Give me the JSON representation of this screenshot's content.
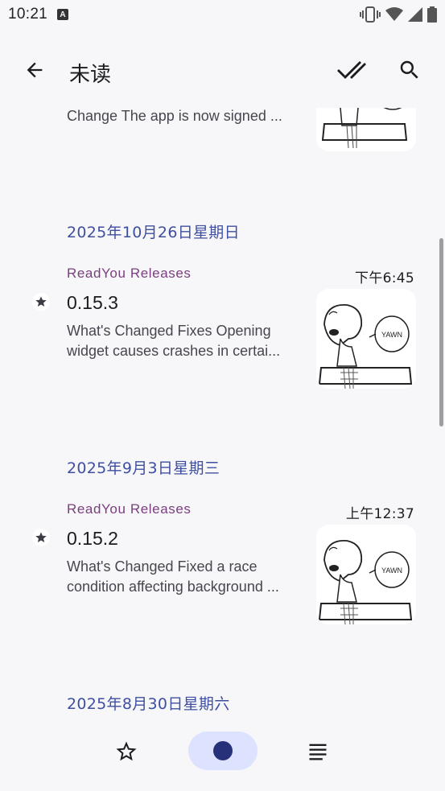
{
  "status_bar": {
    "time": "10:21",
    "notification_icon": "A",
    "icons": [
      "vibrate-icon",
      "wifi-icon",
      "signal-icon",
      "battery-icon"
    ]
  },
  "toolbar": {
    "title": "未读",
    "back_icon": "arrow-back-icon",
    "mark_all_icon": "done-all-icon",
    "search_icon": "search-icon"
  },
  "partial_item": {
    "description": "Change The app is now signed ..."
  },
  "sections": [
    {
      "date": "2025年10月26日星期日",
      "items": [
        {
          "feed": "ReadYou Releases",
          "time": "下午6:45",
          "title": "0.15.3",
          "desc_line1": "What's Changed Fixes Opening",
          "desc_line2": "widget causes crashes in certai..."
        }
      ]
    },
    {
      "date": "2025年9月3日星期三",
      "items": [
        {
          "feed": "ReadYou Releases",
          "time": "上午12:37",
          "title": "0.15.2",
          "desc_line1": "What's Changed Fixed a race",
          "desc_line2": "condition affecting background ..."
        }
      ]
    },
    {
      "date": "2025年8月30日星期六",
      "items": []
    }
  ],
  "thumbnail": {
    "speech_text": "YAWN"
  },
  "bottom_nav": {
    "items": [
      {
        "icon": "star-outline-icon",
        "selected": false
      },
      {
        "icon": "filled-circle-icon",
        "selected": true
      },
      {
        "icon": "subject-lines-icon",
        "selected": false
      }
    ]
  },
  "colors": {
    "accent": "#3f4fa0",
    "feed_name": "#7a3f7e",
    "selected_pill": "#dde2ff",
    "nav_dot": "#27317a"
  }
}
